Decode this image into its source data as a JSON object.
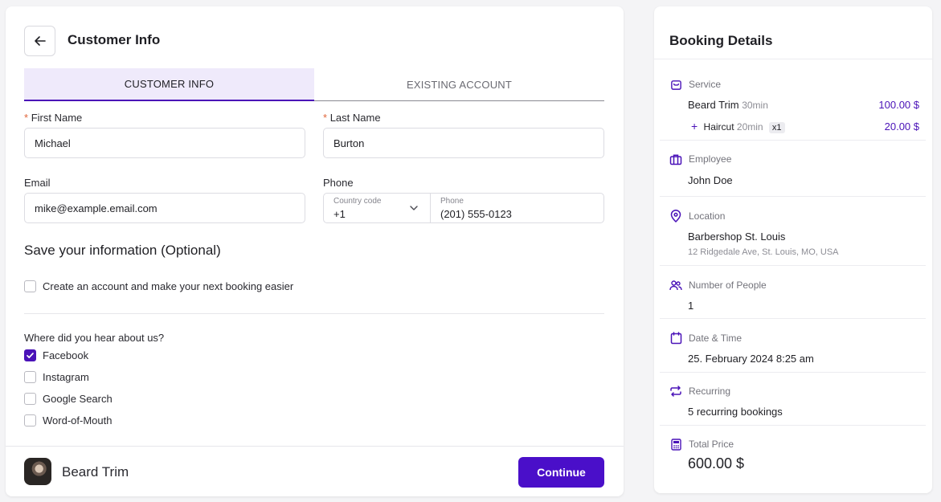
{
  "page": {
    "title": "Customer Info"
  },
  "tabs": [
    {
      "label": "CUSTOMER INFO",
      "active": true
    },
    {
      "label": "EXISTING ACCOUNT",
      "active": false
    }
  ],
  "form": {
    "first_name": {
      "label": "First Name",
      "required": "*",
      "value": "Michael"
    },
    "last_name": {
      "label": "Last Name",
      "required": "*",
      "value": "Burton"
    },
    "email": {
      "label": "Email",
      "value": "mike@example.email.com"
    },
    "phone": {
      "label": "Phone",
      "country_code_label": "Country code",
      "country_code_value": "+1",
      "number_label": "Phone",
      "number_value": "(201) 555-0123"
    }
  },
  "save_section": {
    "title": "Save your information (Optional)",
    "create_account_label": "Create an account and make your next booking easier",
    "create_account_checked": false
  },
  "hear_about": {
    "question": "Where did you hear about us?",
    "options": [
      {
        "label": "Facebook",
        "checked": true
      },
      {
        "label": "Instagram",
        "checked": false
      },
      {
        "label": "Google Search",
        "checked": false
      },
      {
        "label": "Word-of-Mouth",
        "checked": false
      }
    ]
  },
  "footer": {
    "service_name": "Beard Trim",
    "continue_label": "Continue"
  },
  "booking": {
    "title": "Booking Details",
    "service": {
      "heading": "Service",
      "main_name": "Beard Trim",
      "main_duration": "30min",
      "main_price": "100.00 $",
      "extra_prefix": "+",
      "extra_name": "Haircut",
      "extra_duration": "20min",
      "extra_qty": "x1",
      "extra_price": "20.00 $"
    },
    "employee": {
      "heading": "Employee",
      "value": "John Doe"
    },
    "location": {
      "heading": "Location",
      "value": "Barbershop St. Louis",
      "address": "12 Ridgedale Ave, St. Louis, MO, USA"
    },
    "people": {
      "heading": "Number of People",
      "value": "1"
    },
    "datetime": {
      "heading": "Date & Time",
      "value": "25. February 2024  8:25 am"
    },
    "recurring": {
      "heading": "Recurring",
      "value": "5 recurring bookings"
    },
    "total": {
      "heading": "Total Price",
      "value": "600.00 $"
    }
  },
  "colors": {
    "accent": "#4a12b8",
    "button": "#4a0fc9",
    "required": "#e0653a"
  },
  "icons": [
    "arrow-left-icon",
    "chevron-down-icon",
    "check-icon",
    "bag-icon",
    "briefcase-icon",
    "location-pin-icon",
    "people-icon",
    "calendar-icon",
    "repeat-icon",
    "calculator-icon"
  ]
}
